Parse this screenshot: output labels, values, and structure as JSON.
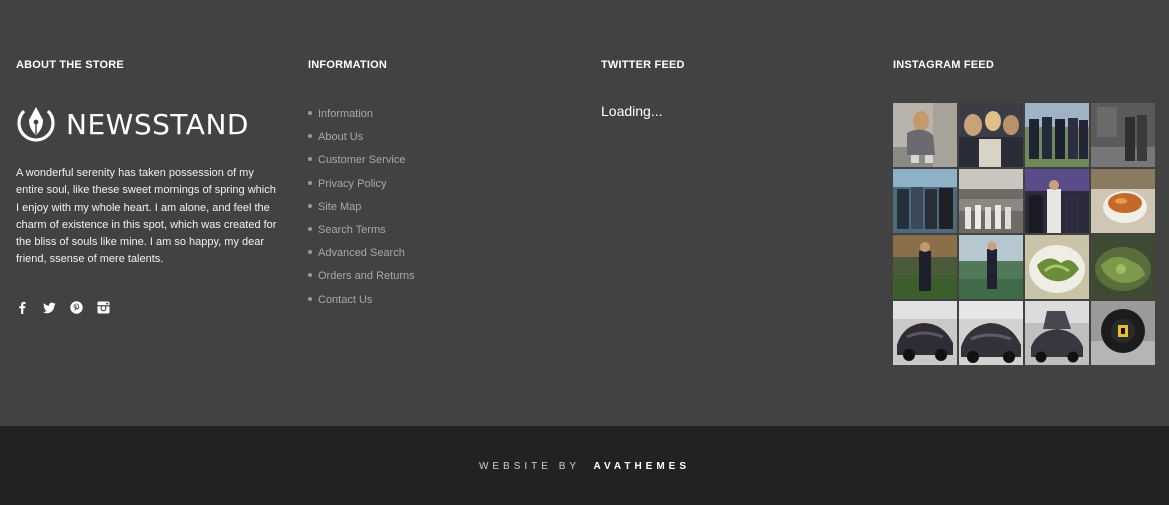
{
  "about": {
    "title": "ABOUT THE STORE",
    "logo_text": "NEWSSTAND",
    "logo_icon": "pen-nib-icon",
    "text": "A wonderful serenity has taken possession of my entire soul, like these sweet mornings of spring which I enjoy with my whole heart. I am alone, and feel the charm of existence in this spot, which was created for the bliss of souls like mine. I am so happy, my dear friend, ssense of mere talents.",
    "social": [
      "facebook-icon",
      "twitter-icon",
      "pinterest-icon",
      "instagram-icon"
    ]
  },
  "information": {
    "title": "INFORMATION",
    "links": [
      "Information",
      "About Us",
      "Customer Service",
      "Privacy Policy",
      "Site Map",
      "Search Terms",
      "Advanced Search",
      "Orders and Returns",
      "Contact Us"
    ]
  },
  "twitter": {
    "title": "TWITTER FEED",
    "status": "Loading..."
  },
  "instagram": {
    "title": "INSTAGRAM FEED"
  },
  "credit": {
    "prefix": "WEBSITE BY",
    "brand": "AVATHEMES"
  },
  "colors": {
    "footer_bg": "#424242",
    "bottom_bg": "#222222",
    "link": "#a8a8a8",
    "text": "#ffffff"
  }
}
